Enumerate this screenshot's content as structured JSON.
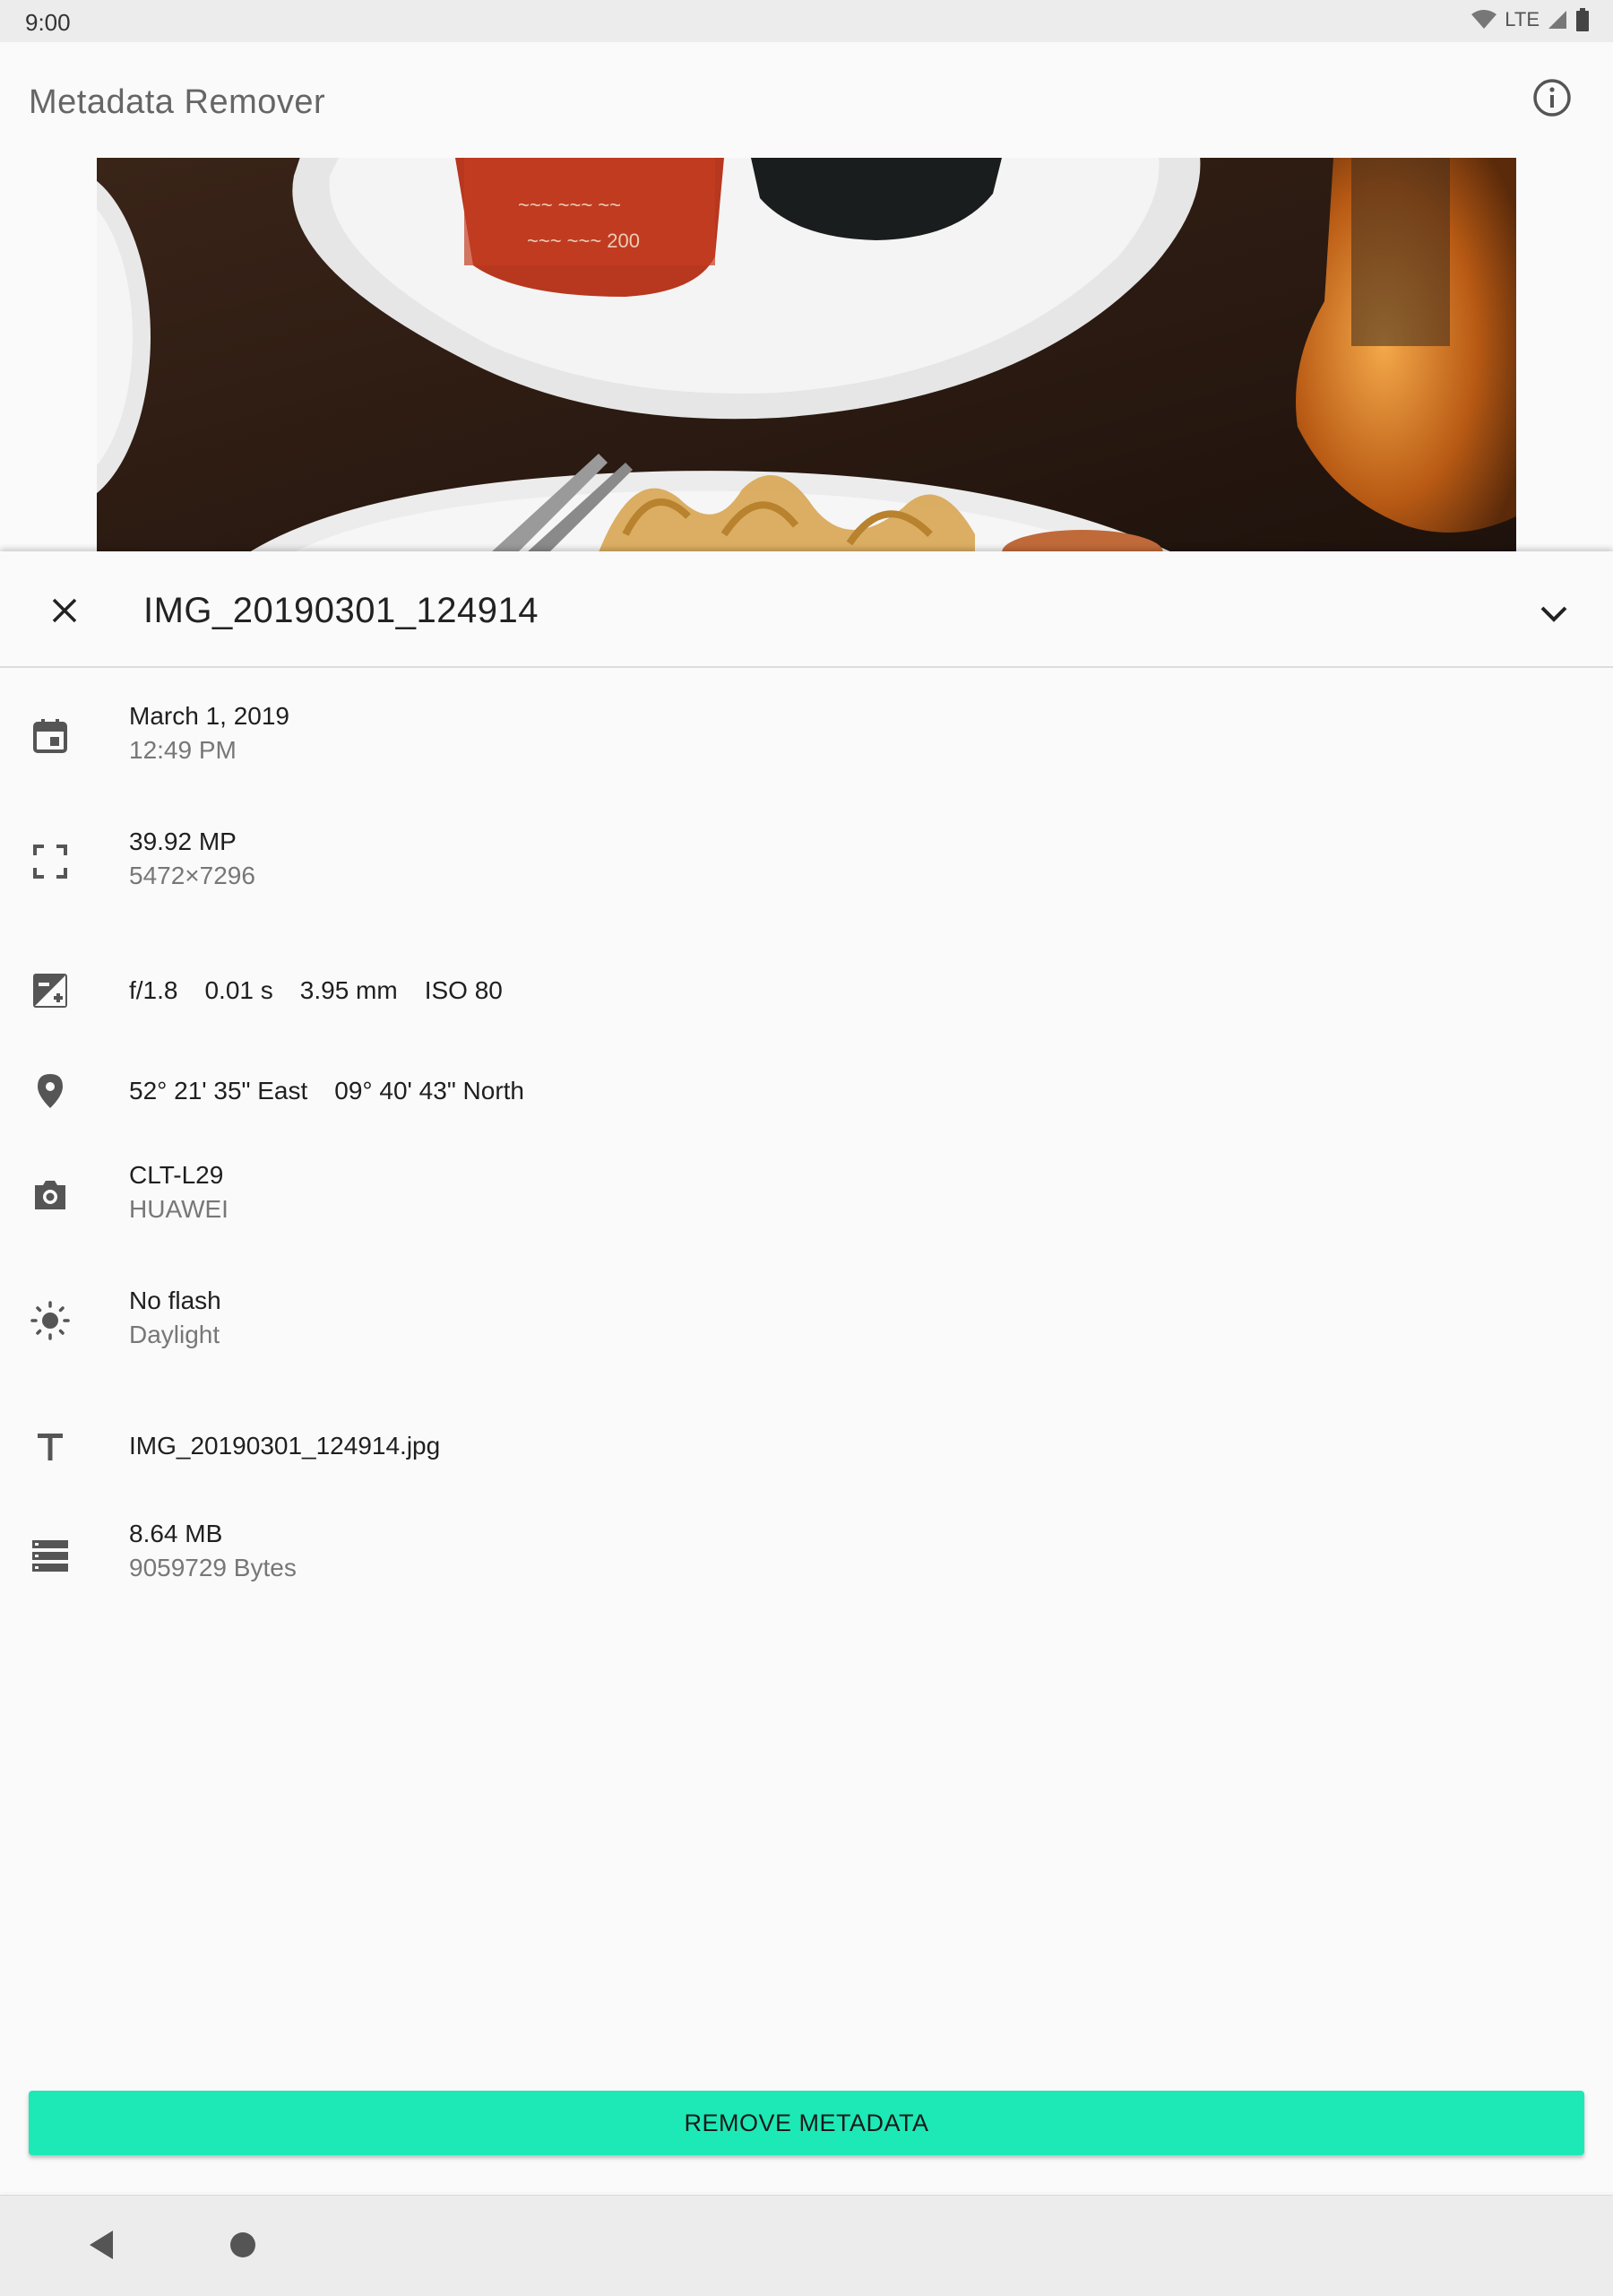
{
  "status_bar": {
    "time": "9:00",
    "network": "LTE"
  },
  "app_bar": {
    "title": "Metadata Remover",
    "info_icon": "info-icon"
  },
  "sheet": {
    "title": "IMG_20190301_124914",
    "close_icon": "close-icon",
    "collapse_icon": "chevron-down-icon"
  },
  "details": {
    "date": {
      "icon": "calendar-icon",
      "primary": "March 1, 2019",
      "secondary": "12:49 PM"
    },
    "resolution": {
      "icon": "fullscreen-icon",
      "primary": "39.92 MP",
      "secondary": "5472×7296"
    },
    "exposure": {
      "icon": "exposure-icon",
      "aperture": "f/1.8",
      "shutter": "0.01 s",
      "focal": "3.95 mm",
      "iso": "ISO 80"
    },
    "location": {
      "icon": "location-pin-icon",
      "longitude": "52° 21' 35\" East",
      "latitude": "09° 40' 43\" North"
    },
    "camera": {
      "icon": "camera-icon",
      "primary": "CLT-L29",
      "secondary": "HUAWEI"
    },
    "flash": {
      "icon": "brightness-icon",
      "primary": "No flash",
      "secondary": "Daylight"
    },
    "filename": {
      "icon": "text-icon",
      "primary": "IMG_20190301_124914.jpg"
    },
    "size": {
      "icon": "storage-icon",
      "primary": "8.64 MB",
      "secondary": "9059729 Bytes"
    }
  },
  "actions": {
    "remove_label": "REMOVE METADATA"
  },
  "colors": {
    "accent": "#1de9b6",
    "icon": "#555555",
    "secondary_text": "#777777"
  },
  "nav_bar": {
    "back_icon": "back-triangle-icon",
    "home_icon": "home-circle-icon"
  }
}
